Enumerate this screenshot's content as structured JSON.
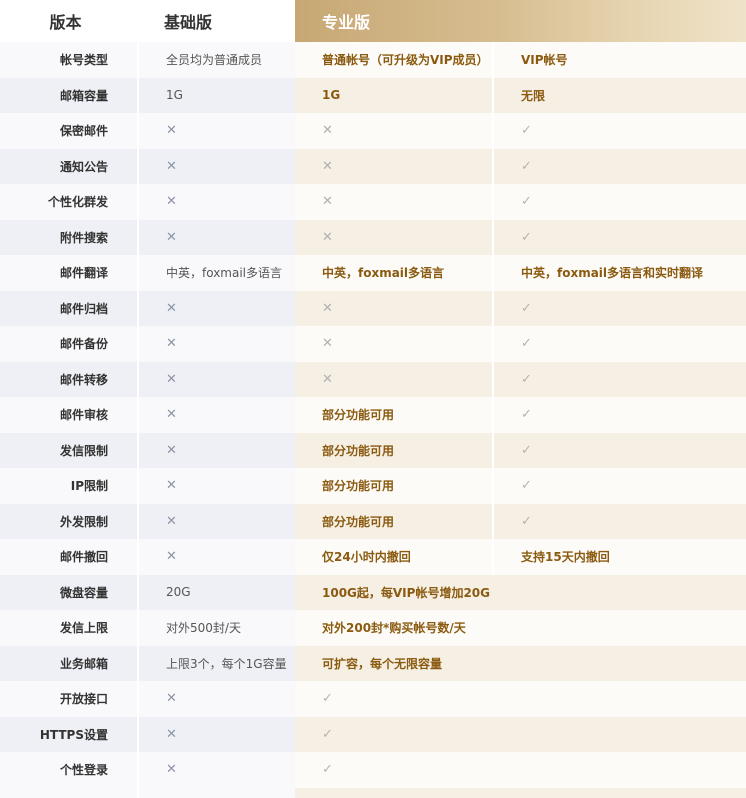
{
  "header": {
    "feature_col": "版本",
    "basic_col": "基础版",
    "pro_col": "专业版"
  },
  "rows": [
    {
      "label": "帐号类型",
      "basic": "全员均为普通成员",
      "pro_normal": "普通帐号（可升级为VIP成员）",
      "pro_vip": "VIP帐号"
    },
    {
      "label": "邮箱容量",
      "basic": "1G",
      "pro_normal": "1G",
      "pro_vip": "无限"
    },
    {
      "label": "保密邮件",
      "basic": "✕",
      "pro_normal": "✕",
      "pro_vip": "✓"
    },
    {
      "label": "通知公告",
      "basic": "✕",
      "pro_normal": "✕",
      "pro_vip": "✓"
    },
    {
      "label": "个性化群发",
      "basic": "✕",
      "pro_normal": "✕",
      "pro_vip": "✓"
    },
    {
      "label": "附件搜索",
      "basic": "✕",
      "pro_normal": "✕",
      "pro_vip": "✓"
    },
    {
      "label": "邮件翻译",
      "basic": "中英，foxmail多语言",
      "pro_normal": "中英，foxmail多语言",
      "pro_vip": "中英，foxmail多语言和实时翻译"
    },
    {
      "label": "邮件归档",
      "basic": "✕",
      "pro_normal": "✕",
      "pro_vip": "✓"
    },
    {
      "label": "邮件备份",
      "basic": "✕",
      "pro_normal": "✕",
      "pro_vip": "✓"
    },
    {
      "label": "邮件转移",
      "basic": "✕",
      "pro_normal": "✕",
      "pro_vip": "✓"
    },
    {
      "label": "邮件审核",
      "basic": "✕",
      "pro_normal": "部分功能可用",
      "pro_vip": "✓"
    },
    {
      "label": "发信限制",
      "basic": "✕",
      "pro_normal": "部分功能可用",
      "pro_vip": "✓"
    },
    {
      "label": "IP限制",
      "basic": "✕",
      "pro_normal": "部分功能可用",
      "pro_vip": "✓"
    },
    {
      "label": "外发限制",
      "basic": "✕",
      "pro_normal": "部分功能可用",
      "pro_vip": "✓"
    },
    {
      "label": "邮件撤回",
      "basic": "✕",
      "pro_normal": "仅24小时内撤回",
      "pro_vip": "支持15天内撤回"
    },
    {
      "label": "微盘容量",
      "basic": "20G",
      "pro": "100G起，每VIP帐号增加20G"
    },
    {
      "label": "发信上限",
      "basic": "对外500封/天",
      "pro": "对外200封*购买帐号数/天"
    },
    {
      "label": "业务邮箱",
      "basic": "上限3个，每个1G容量",
      "pro": "可扩容，每个无限容量"
    },
    {
      "label": "开放接口",
      "basic": "✕",
      "pro": "✓"
    },
    {
      "label": "HTTPS设置",
      "basic": "✕",
      "pro": "✓"
    },
    {
      "label": "个性登录",
      "basic": "✕",
      "pro": "✓"
    }
  ]
}
